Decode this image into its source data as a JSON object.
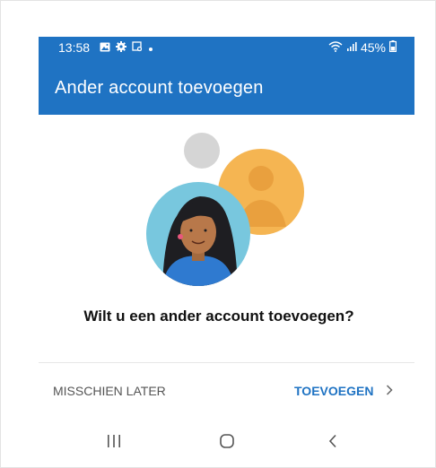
{
  "status_bar": {
    "time": "13:58",
    "battery": "45%",
    "icons": [
      "image-icon",
      "gear-icon",
      "screenshot-icon",
      "dot-icon",
      "wifi-icon",
      "signal-icon",
      "battery-icon"
    ]
  },
  "app_bar": {
    "title": "Ander account toevoegen",
    "color": "#1f73c3"
  },
  "main": {
    "question": "Wilt u een ander account toevoegen?"
  },
  "actions": {
    "later_label": "MISSCHIEN LATER",
    "add_label": "TOEVOEGEN",
    "add_color": "#1f73c3"
  },
  "nav_bar": {
    "buttons": [
      "recents-icon",
      "home-icon",
      "back-icon"
    ]
  }
}
